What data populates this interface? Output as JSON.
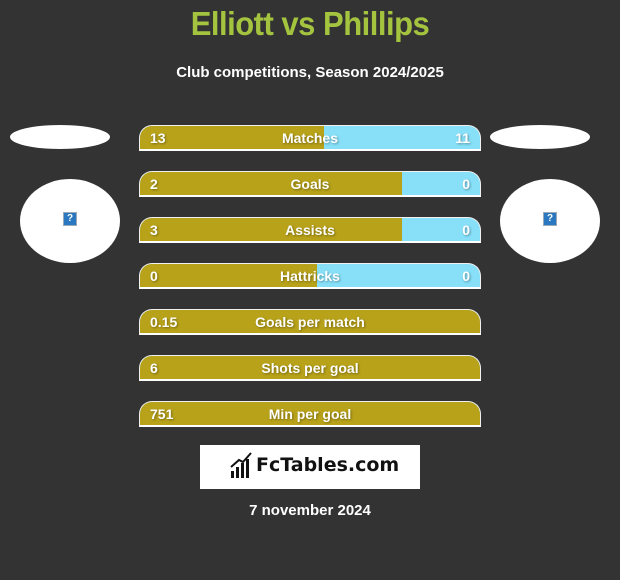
{
  "header": {
    "title": "Elliott vs Phillips",
    "subtitle": "Club competitions, Season 2024/2025"
  },
  "colors": {
    "background": "#333333",
    "title": "#a4c33f",
    "left_bar": "#b8a21a",
    "right_bar": "#87e0f8"
  },
  "players": {
    "left": {
      "name": "Elliott",
      "badge_icon": "unknown-image-icon"
    },
    "right": {
      "name": "Phillips",
      "badge_icon": "unknown-image-icon"
    }
  },
  "stats": [
    {
      "label": "Matches",
      "left": "13",
      "right": "11",
      "left_share": 0.54
    },
    {
      "label": "Goals",
      "left": "2",
      "right": "0",
      "left_share": 0.77
    },
    {
      "label": "Assists",
      "left": "3",
      "right": "0",
      "left_share": 0.77
    },
    {
      "label": "Hattricks",
      "left": "0",
      "right": "0",
      "left_share": 0.52
    },
    {
      "label": "Goals per match",
      "left": "0.15",
      "right": "",
      "left_share": 1.0
    },
    {
      "label": "Shots per goal",
      "left": "6",
      "right": "",
      "left_share": 1.0
    },
    {
      "label": "Min per goal",
      "left": "751",
      "right": "",
      "left_share": 1.0
    }
  ],
  "footer": {
    "logo_text": "FcTables.com",
    "date": "7 november 2024"
  }
}
